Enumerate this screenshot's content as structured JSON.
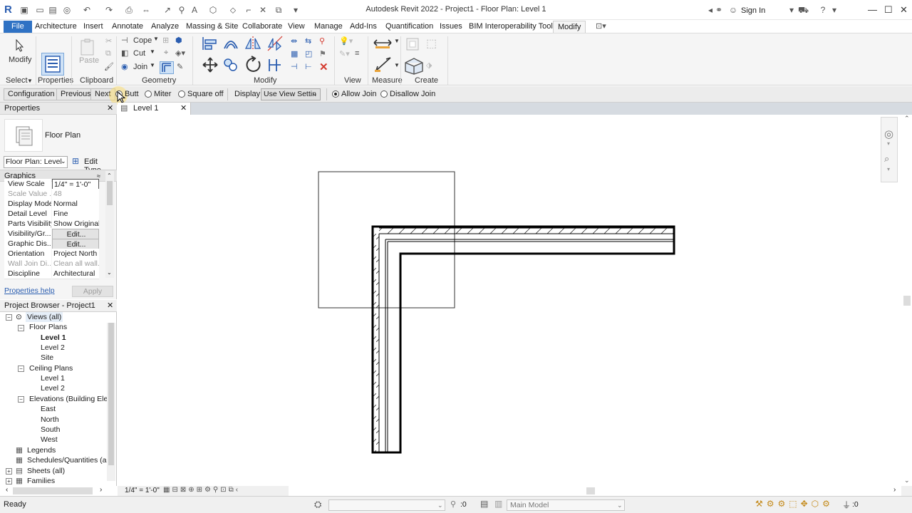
{
  "app": {
    "title": "Autodesk Revit 2022 - Project1 - Floor Plan: Level 1",
    "sign_in": "Sign In"
  },
  "menu": {
    "tabs": [
      "File",
      "Architecture",
      "Insert",
      "Annotate",
      "Analyze",
      "Massing & Site",
      "Collaborate",
      "View",
      "Manage",
      "Add-Ins",
      "Quantification",
      "Issues",
      "BIM Interoperability Tools",
      "Modify"
    ]
  },
  "ribbon": {
    "modify_label": "Modify",
    "paste_label": "Paste",
    "cope_label": "Cope",
    "cut_label": "Cut",
    "join_label": "Join",
    "panels": {
      "select": "Select",
      "properties": "Properties",
      "clipboard": "Clipboard",
      "geometry": "Geometry",
      "modify": "Modify",
      "view": "View",
      "measure": "Measure",
      "create": "Create"
    }
  },
  "options_bar": {
    "configuration": "Configuration",
    "previous": "Previous",
    "next": "Next",
    "butt": "Butt",
    "miter": "Miter",
    "square_off": "Square off",
    "display": "Display",
    "display_value": "Use View Settin",
    "allow_join": "Allow Join",
    "disallow_join": "Disallow Join"
  },
  "properties": {
    "title": "Properties",
    "type_name": "Floor Plan",
    "selector": "Floor Plan: Level",
    "edit_type": "Edit Type",
    "section": "Graphics",
    "rows": [
      {
        "key": "View Scale",
        "value": "1/4\" = 1'-0\""
      },
      {
        "key": "Scale Value ...",
        "value": "48"
      },
      {
        "key": "Display Model",
        "value": "Normal"
      },
      {
        "key": "Detail Level",
        "value": "Fine"
      },
      {
        "key": "Parts Visibility",
        "value": "Show Original"
      },
      {
        "key": "Visibility/Gr...",
        "value": "Edit..."
      },
      {
        "key": "Graphic Dis...",
        "value": "Edit..."
      },
      {
        "key": "Orientation",
        "value": "Project North"
      },
      {
        "key": "Wall Join Di...",
        "value": "Clean all wall..."
      },
      {
        "key": "Discipline",
        "value": "Architectural"
      }
    ],
    "help": "Properties help",
    "apply": "Apply"
  },
  "browser": {
    "title": "Project Browser - Project1",
    "nodes": {
      "views": "Views (all)",
      "floor_plans": "Floor Plans",
      "fp_level1": "Level 1",
      "fp_level2": "Level 2",
      "fp_site": "Site",
      "ceiling_plans": "Ceiling Plans",
      "cp_level1": "Level 1",
      "cp_level2": "Level 2",
      "elevations": "Elevations (Building Eleva",
      "east": "East",
      "north": "North",
      "south": "South",
      "west": "West",
      "legends": "Legends",
      "schedules": "Schedules/Quantities (all)",
      "sheets": "Sheets (all)",
      "families": "Families"
    }
  },
  "view": {
    "tab_label": "Level 1",
    "scale": "1/4\" = 1'-0\""
  },
  "status": {
    "ready": "Ready",
    "workset_count": ":0",
    "model": "Main Model",
    "filter_count": ":0"
  },
  "colors": {
    "file_tab": "#2f72c4",
    "accent_blue": "#2a5db0",
    "delete_red": "#d43a2f"
  }
}
